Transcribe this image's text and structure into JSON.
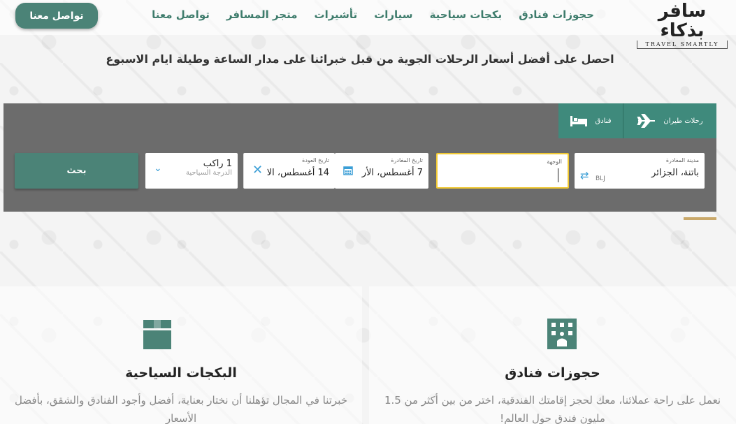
{
  "header": {
    "contact_button": "تواصل معنا",
    "nav": [
      "حجوزات فنادق",
      "بكجات سياحية",
      "سيارات",
      "تأشيرات",
      "متجر المسافر",
      "تواصل معنا"
    ],
    "logo_ar": "سافر بذكاء",
    "logo_en": "TRAVEL SMARTLY"
  },
  "headline": "احصل على أفضل أسعار الرحلات الجوية من قبل خبرائنا على مدار الساعة وطيلة ايام الاسبوع",
  "search": {
    "tabs": [
      {
        "label": "رحلات طيران",
        "icon": "airplane-icon"
      },
      {
        "label": "فنادق",
        "icon": "bed-icon"
      }
    ],
    "origin": {
      "label": "مدينة المغادرة",
      "value": "باتنة، الجزائر",
      "code": "BLJ"
    },
    "destination": {
      "label": "الوجهة",
      "value": ""
    },
    "depart": {
      "label": "تاريخ المغادرة",
      "value": "7 أغسطس، الأر"
    },
    "return": {
      "label": "تاريخ العودة",
      "value": "14 أغسطس، الا"
    },
    "passengers": {
      "value": "1 راكب",
      "class": "الدرجة السياحية"
    },
    "button": "بحث"
  },
  "cards": [
    {
      "title": "البكجات السياحية",
      "text": "خبرتنا في المجال تؤهلنا أن نختار بعناية، أفضل وأجود الفنادق والشقق، بأفضل الأسعار",
      "icon": "box-icon"
    },
    {
      "title": "حجوزات فنادق",
      "text": "نعمل على راحة عملائنا، معك لحجز إقامتك الفندقية، اختر من بين أكثر من 1.5 مليون فندق حول العالم!",
      "icon": "hotel-icon"
    }
  ],
  "colors": {
    "accent": "#4b8377",
    "nav": "#3e7c6c",
    "panel": "#6c6c6c",
    "highlight": "#f0c832",
    "icon_blue": "#3a9ed6"
  }
}
